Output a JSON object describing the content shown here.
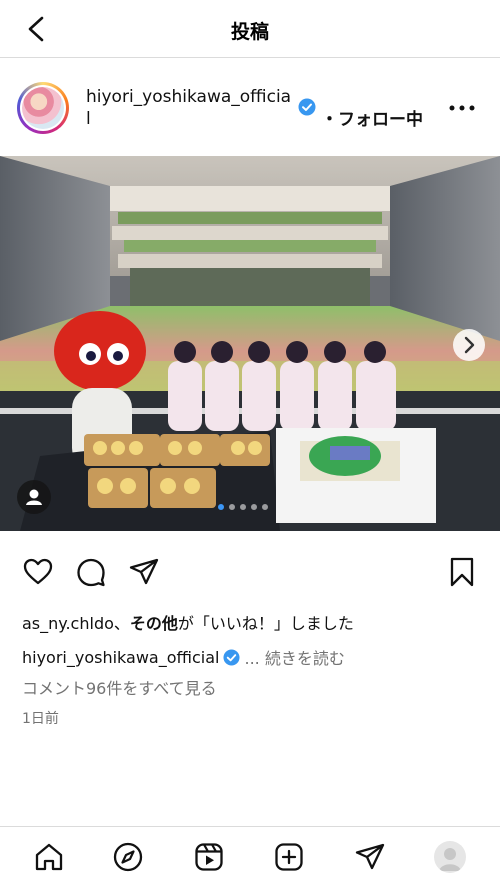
{
  "topbar": {
    "title": "投稿",
    "back_icon": "chevron-left-icon"
  },
  "post": {
    "username_line1": "hiyori_yoshikawa_officia",
    "username_line2": "l",
    "follow_status": "・フォロー中",
    "more_icon": "more-horizontal-icon",
    "photo_description_icon": "user-tag-icon",
    "carousel": {
      "total": 5,
      "active_index": 0
    },
    "likes": {
      "liked_by": "as_ny.chldo",
      "separator": "、",
      "others": "その他",
      "suffix": "が「いいね！」しました"
    },
    "caption": {
      "user": "hiyori_yoshikawa_official",
      "more": "... 続きを読む"
    },
    "comments_link": "コメント96件をすべて見る",
    "timestamp": "1日前"
  },
  "colors": {
    "verified": "#3897f0",
    "active_dot": "#3b96f5",
    "muted_text": "#737373"
  },
  "bottom_nav": [
    "home-icon",
    "explore-icon",
    "reels-icon",
    "create-icon",
    "direct-icon",
    "profile-avatar"
  ]
}
